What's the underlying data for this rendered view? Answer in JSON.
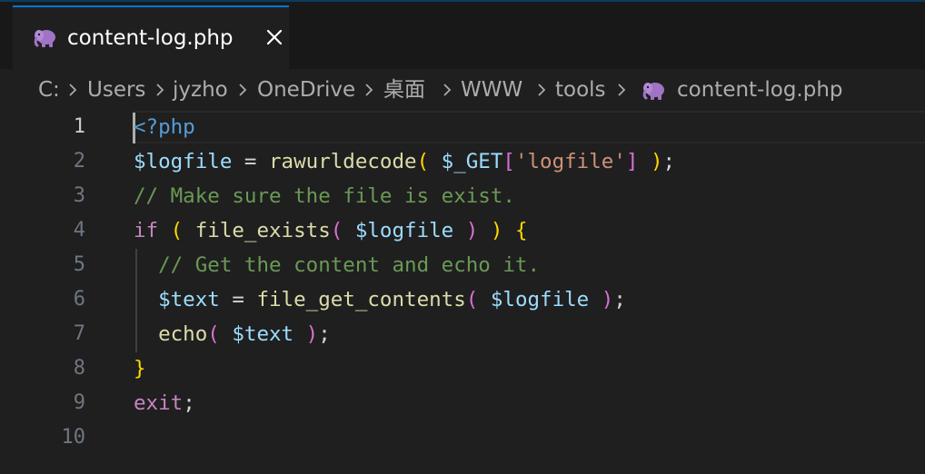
{
  "tab": {
    "label": "content-log.php",
    "icon": "php-elephant-icon",
    "close_icon": "close-icon"
  },
  "breadcrumb": {
    "segments": [
      "C:",
      "Users",
      "jyzho",
      "OneDrive",
      "桌面",
      "WWW",
      "tools",
      "content-log.php"
    ]
  },
  "editor": {
    "active_line": "1",
    "line_numbers": [
      "1",
      "2",
      "3",
      "4",
      "5",
      "6",
      "7",
      "8",
      "9",
      "10"
    ],
    "lines": [
      [
        {
          "t": "<?php",
          "c": "tag"
        }
      ],
      [
        {
          "t": "$logfile",
          "c": "var"
        },
        {
          "t": " = ",
          "c": "op"
        },
        {
          "t": "rawurldecode",
          "c": "fn"
        },
        {
          "t": "( ",
          "c": "p1"
        },
        {
          "t": "$_GET",
          "c": "var"
        },
        {
          "t": "[",
          "c": "p2"
        },
        {
          "t": "'logfile'",
          "c": "str"
        },
        {
          "t": "]",
          "c": "p2"
        },
        {
          "t": " )",
          "c": "p1"
        },
        {
          "t": ";",
          "c": "op"
        }
      ],
      [
        {
          "t": "// Make sure the file is exist.",
          "c": "cmt"
        }
      ],
      [
        {
          "t": "if",
          "c": "kw"
        },
        {
          "t": " ",
          "c": "op"
        },
        {
          "t": "(",
          "c": "p1"
        },
        {
          "t": " ",
          "c": "op"
        },
        {
          "t": "file_exists",
          "c": "fn"
        },
        {
          "t": "( ",
          "c": "p2"
        },
        {
          "t": "$logfile",
          "c": "var"
        },
        {
          "t": " )",
          "c": "p2"
        },
        {
          "t": " ",
          "c": "op"
        },
        {
          "t": ")",
          "c": "p1"
        },
        {
          "t": " ",
          "c": "op"
        },
        {
          "t": "{",
          "c": "p1"
        }
      ],
      [
        {
          "t": "  ",
          "c": "op"
        },
        {
          "t": "// Get the content and echo it.",
          "c": "cmt"
        }
      ],
      [
        {
          "t": "  ",
          "c": "op"
        },
        {
          "t": "$text",
          "c": "var"
        },
        {
          "t": " = ",
          "c": "op"
        },
        {
          "t": "file_get_contents",
          "c": "fn"
        },
        {
          "t": "( ",
          "c": "p2"
        },
        {
          "t": "$logfile",
          "c": "var"
        },
        {
          "t": " )",
          "c": "p2"
        },
        {
          "t": ";",
          "c": "op"
        }
      ],
      [
        {
          "t": "  ",
          "c": "op"
        },
        {
          "t": "echo",
          "c": "fn"
        },
        {
          "t": "( ",
          "c": "p2"
        },
        {
          "t": "$text",
          "c": "var"
        },
        {
          "t": " )",
          "c": "p2"
        },
        {
          "t": ";",
          "c": "op"
        }
      ],
      [
        {
          "t": "}",
          "c": "p1"
        }
      ],
      [
        {
          "t": "exit",
          "c": "kw"
        },
        {
          "t": ";",
          "c": "op"
        }
      ],
      []
    ]
  },
  "colors": {
    "background": "#1f1f1f",
    "tab_bar": "#181818",
    "accent": "#0078d4",
    "php_icon": "#a074c4"
  }
}
